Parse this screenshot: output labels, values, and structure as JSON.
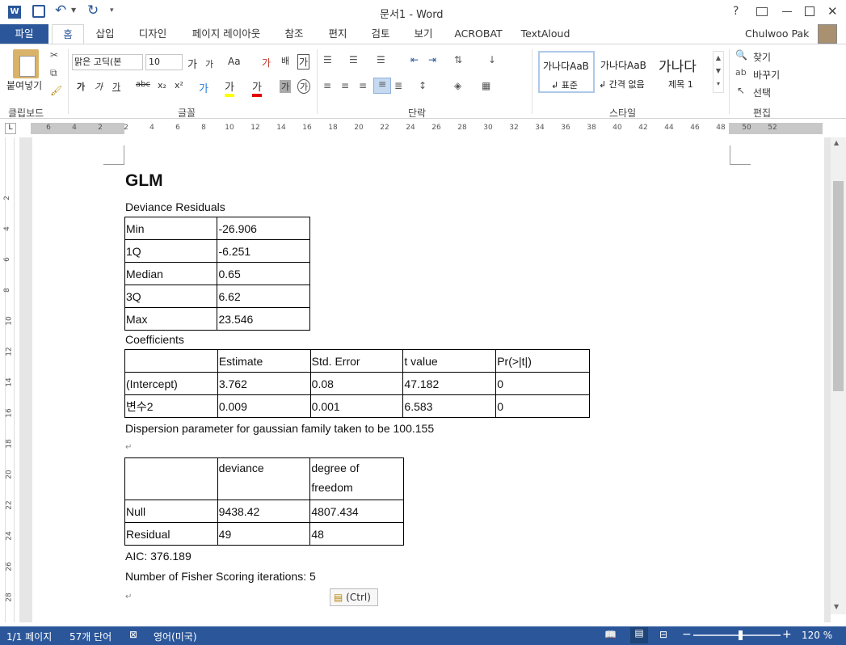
{
  "window": {
    "title": "문서1 - Word",
    "user": "Chulwoo Pak",
    "help": "?",
    "controls": [
      "?",
      "⧉",
      "—",
      "☐",
      "✕"
    ]
  },
  "tabs": [
    "파일",
    "홈",
    "삽입",
    "디자인",
    "페이지 레이아웃",
    "참조",
    "편지",
    "검토",
    "보기",
    "ACROBAT",
    "TextAloud"
  ],
  "ribbon": {
    "clipboard": {
      "paste": "붙여넣기",
      "label": "클립보드"
    },
    "font": {
      "name": "맑은 고딕(본",
      "size": "10",
      "label": "글꼴",
      "grow": "가",
      "shrink": "가",
      "case": "Aa",
      "clear": "가",
      "phonetic": "배",
      "border": "가",
      "bold": "가",
      "italic": "가",
      "underline": "가",
      "strike": "abc",
      "sub": "x₂",
      "sup": "x²",
      "effects": "가",
      "highlight": "가",
      "color": "가",
      "shade": "가",
      "enclose": "가"
    },
    "paragraph": {
      "label": "단락"
    },
    "styles": {
      "label": "스타일",
      "items": [
        {
          "preview": "가나다AaB",
          "name": "↲ 표준"
        },
        {
          "preview": "가나다AaB",
          "name": "↲ 간격 없음"
        },
        {
          "preview": "가나다",
          "name": "제목 1"
        }
      ]
    },
    "editing": {
      "label": "편집",
      "find": "찾기",
      "replace": "바꾸기",
      "select": "선택"
    }
  },
  "ruler": {
    "h": [
      "6",
      "4",
      "2",
      "2",
      "4",
      "6",
      "8",
      "10",
      "12",
      "14",
      "16",
      "18",
      "20",
      "22",
      "24",
      "26",
      "28",
      "30",
      "32",
      "34",
      "36",
      "38",
      "40",
      "42",
      "44",
      "46",
      "48",
      "50",
      "52"
    ],
    "v": [
      "2",
      "4",
      "6",
      "8",
      "10",
      "12",
      "14",
      "16",
      "18",
      "20",
      "22",
      "24",
      "26",
      "28"
    ]
  },
  "document": {
    "heading": "GLM",
    "deviance_title": "Deviance Residuals",
    "deviance_rows": [
      [
        "Min",
        "-26.906"
      ],
      [
        "1Q",
        "-6.251"
      ],
      [
        "Median",
        "0.65"
      ],
      [
        "3Q",
        "6.62"
      ],
      [
        "Max",
        "23.546"
      ]
    ],
    "coef_title": "Coefficients",
    "coef_header": [
      "",
      "Estimate",
      "Std. Error",
      "t value",
      "Pr(>|t|)"
    ],
    "coef_rows": [
      [
        "(Intercept)",
        "3.762",
        "0.08",
        "47.182",
        "0"
      ],
      [
        "변수2",
        "0.009",
        "0.001",
        "6.583",
        "0"
      ]
    ],
    "dispersion": "Dispersion parameter for gaussian family taken to be 100.155",
    "dev_header": [
      "",
      "deviance",
      "degree of freedom"
    ],
    "dev_rows": [
      [
        "Null",
        "9438.42",
        "4807.434"
      ],
      [
        "Residual",
        "49",
        "48"
      ]
    ],
    "aic": "AIC: 376.189",
    "fisher": "Number of Fisher Scoring iterations: 5",
    "paste_ctrl": "(Ctrl)"
  },
  "status": {
    "page": "1/1 페이지",
    "words": "57개 단어",
    "lang": "영어(미국)",
    "zoom": "120 %"
  }
}
